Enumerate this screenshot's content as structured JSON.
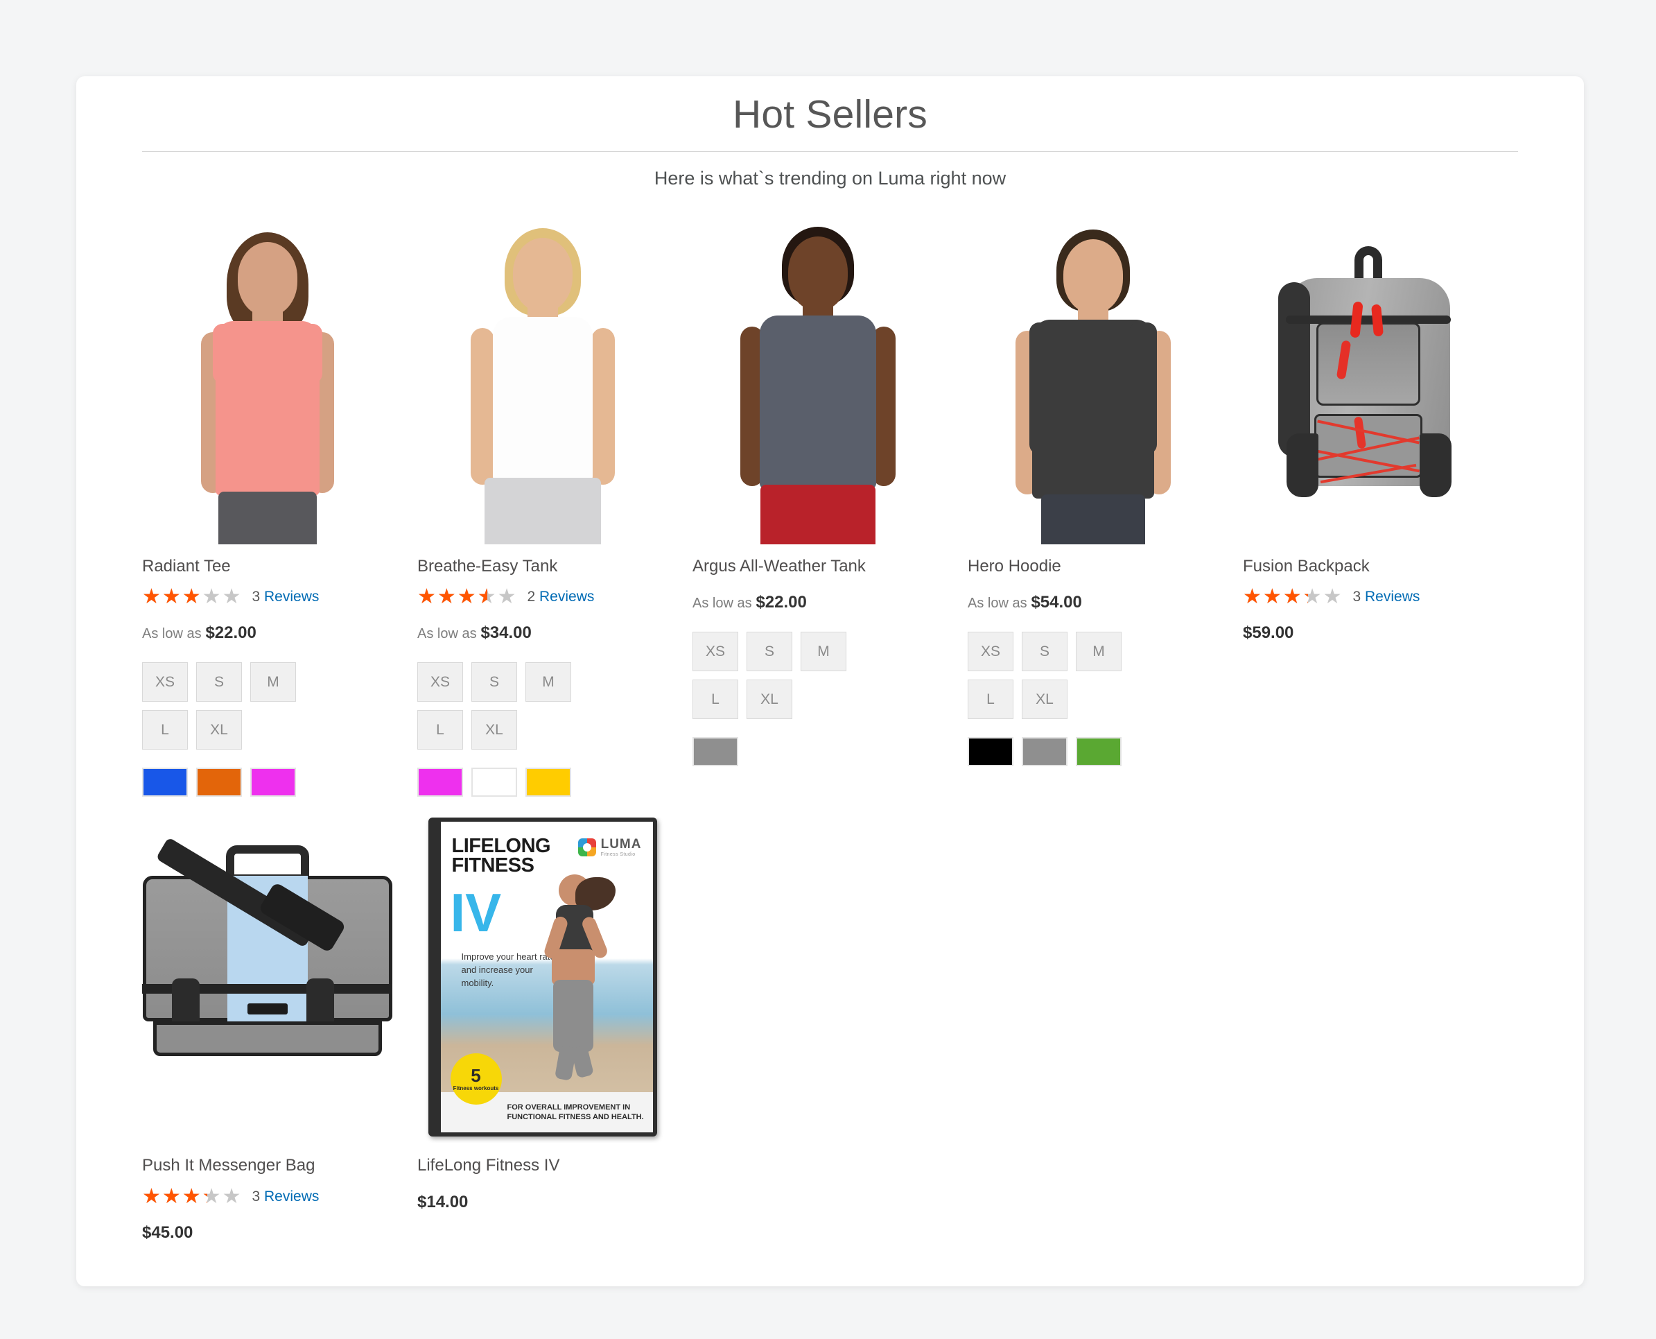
{
  "widget": {
    "title": "Hot Sellers",
    "subtitle": "Here is what`s trending on Luma right now"
  },
  "labels": {
    "as_low_as": "As low as",
    "reviews": "Reviews"
  },
  "products": [
    {
      "name": "Radiant Tee",
      "rating_percent": 60,
      "review_count": "3",
      "reviews_label": "Reviews",
      "price_prefix": "As low as",
      "price": "$22.00",
      "sizes": [
        "XS",
        "S",
        "M",
        "L",
        "XL"
      ],
      "colors": [
        "#1857e8",
        "#e3650a",
        "#ee30ee"
      ],
      "image": "radiant-tee-model"
    },
    {
      "name": "Breathe-Easy Tank",
      "rating_percent": 70,
      "review_count": "2",
      "reviews_label": "Reviews",
      "price_prefix": "As low as",
      "price": "$34.00",
      "sizes": [
        "XS",
        "S",
        "M",
        "L",
        "XL"
      ],
      "colors": [
        "#ee30ee",
        "#ffffff",
        "#ffcc00"
      ],
      "image": "breathe-easy-tank-model"
    },
    {
      "name": "Argus All-Weather Tank",
      "rating_percent": null,
      "review_count": null,
      "reviews_label": null,
      "price_prefix": "As low as",
      "price": "$22.00",
      "sizes": [
        "XS",
        "S",
        "M",
        "L",
        "XL"
      ],
      "colors": [
        "#8f8f8f"
      ],
      "image": "argus-tank-model"
    },
    {
      "name": "Hero Hoodie",
      "rating_percent": null,
      "review_count": null,
      "reviews_label": null,
      "price_prefix": "As low as",
      "price": "$54.00",
      "sizes": [
        "XS",
        "S",
        "M",
        "L",
        "XL"
      ],
      "colors": [
        "#000000",
        "#8f8f8f",
        "#5aa832"
      ],
      "image": "hero-hoodie-model"
    },
    {
      "name": "Fusion Backpack",
      "rating_percent": 65,
      "review_count": "3",
      "reviews_label": "Reviews",
      "price_prefix": null,
      "price": "$59.00",
      "sizes": [],
      "colors": [],
      "image": "fusion-backpack"
    },
    {
      "name": "Push It Messenger Bag",
      "rating_percent": 65,
      "review_count": "3",
      "reviews_label": "Reviews",
      "price_prefix": null,
      "price": "$45.00",
      "sizes": [],
      "colors": [],
      "image": "push-it-messenger-bag"
    },
    {
      "name": "LifeLong Fitness IV",
      "rating_percent": null,
      "review_count": null,
      "reviews_label": null,
      "price_prefix": null,
      "price": "$14.00",
      "sizes": [],
      "colors": [],
      "image": "lifelong-fitness-iv-dvd"
    }
  ],
  "dvd_cover": {
    "title_line1": "LIFELONG",
    "title_line2": "FITNESS",
    "numeral": "IV",
    "tagline": "Improve your heart rate and increase your mobility.",
    "brand_name": "LUMA",
    "brand_sub": "Fitness Studio",
    "badge_number": "5",
    "badge_text": "Fitness workouts",
    "footer_text": "FOR OVERALL IMPROVEMENT IN FUNCTIONAL FITNESS AND HEALTH."
  },
  "colors": {
    "page_background": "#f4f5f6",
    "card_background": "#ffffff",
    "star_filled": "#ff5501",
    "star_empty": "#c7c7c7",
    "link": "#006bb4",
    "title_text": "#575757"
  }
}
